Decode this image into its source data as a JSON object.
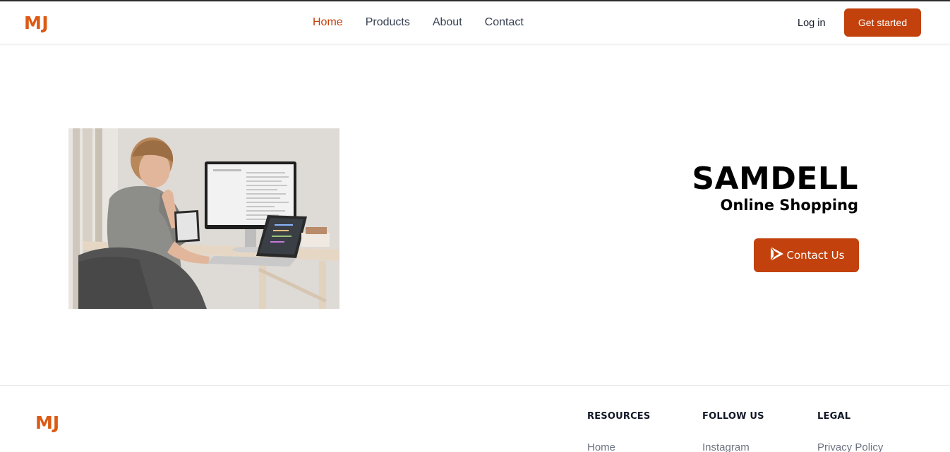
{
  "brand": {
    "logo": "MJ",
    "accent_color": "#c2410c",
    "logo_color": "#dc5a14"
  },
  "header": {
    "nav": [
      {
        "label": "Home",
        "active": true
      },
      {
        "label": "Products",
        "active": false
      },
      {
        "label": "About",
        "active": false
      },
      {
        "label": "Contact",
        "active": false
      }
    ],
    "login_label": "Log in",
    "cta_label": "Get started"
  },
  "hero": {
    "image_icon": "person-at-desk-photo",
    "title": "SAMDELL",
    "subtitle": "Online Shopping",
    "contact_label": "Contact Us",
    "contact_icon": "play-arrow-icon"
  },
  "footer": {
    "logo": "MJ",
    "columns": [
      {
        "heading": "RESOURCES",
        "links": [
          "Home"
        ]
      },
      {
        "heading": "FOLLOW US",
        "links": [
          "Instagram"
        ]
      },
      {
        "heading": "LEGAL",
        "links": [
          "Privacy Policy"
        ]
      }
    ]
  }
}
